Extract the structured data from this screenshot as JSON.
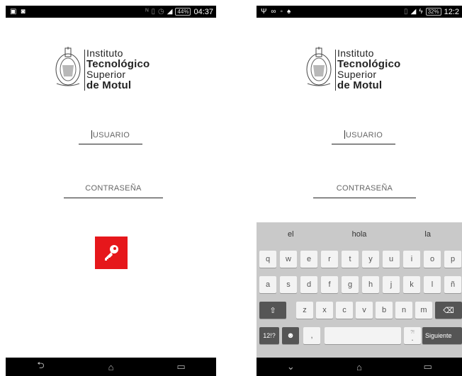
{
  "left": {
    "status": {
      "time": "04:37",
      "battery": "44%"
    },
    "logo": {
      "line1": "Instituto",
      "line2": "Tecnológico",
      "line3": "Superior",
      "line4": "de Motul"
    },
    "username": {
      "placeholder": "USUARIO"
    },
    "password": {
      "placeholder": "CONTRASEÑA"
    },
    "login_icon": "key-icon",
    "nav": [
      "back-icon",
      "home-icon",
      "recents-icon"
    ]
  },
  "right": {
    "status": {
      "time": "12:2",
      "battery": "32%"
    },
    "logo": {
      "line1": "Instituto",
      "line2": "Tecnológico",
      "line3": "Superior",
      "line4": "de Motul"
    },
    "username": {
      "placeholder": "USUARIO"
    },
    "password": {
      "placeholder": "CONTRASEÑA"
    },
    "suggestions": [
      "el",
      "hola",
      "la"
    ],
    "keyboard": {
      "row1": [
        "q",
        "w",
        "e",
        "r",
        "t",
        "y",
        "u",
        "i",
        "o",
        "p"
      ],
      "row2": [
        "a",
        "s",
        "d",
        "f",
        "g",
        "h",
        "j",
        "k",
        "l",
        "ñ"
      ],
      "row3": [
        "z",
        "x",
        "c",
        "v",
        "b",
        "n",
        "m"
      ],
      "symbols_label": "12!?",
      "comma": ",",
      "period": ".",
      "period_hint": "?!",
      "next_label": "Siguiente"
    },
    "nav": [
      "down-icon",
      "home-icon",
      "recents-icon"
    ]
  }
}
